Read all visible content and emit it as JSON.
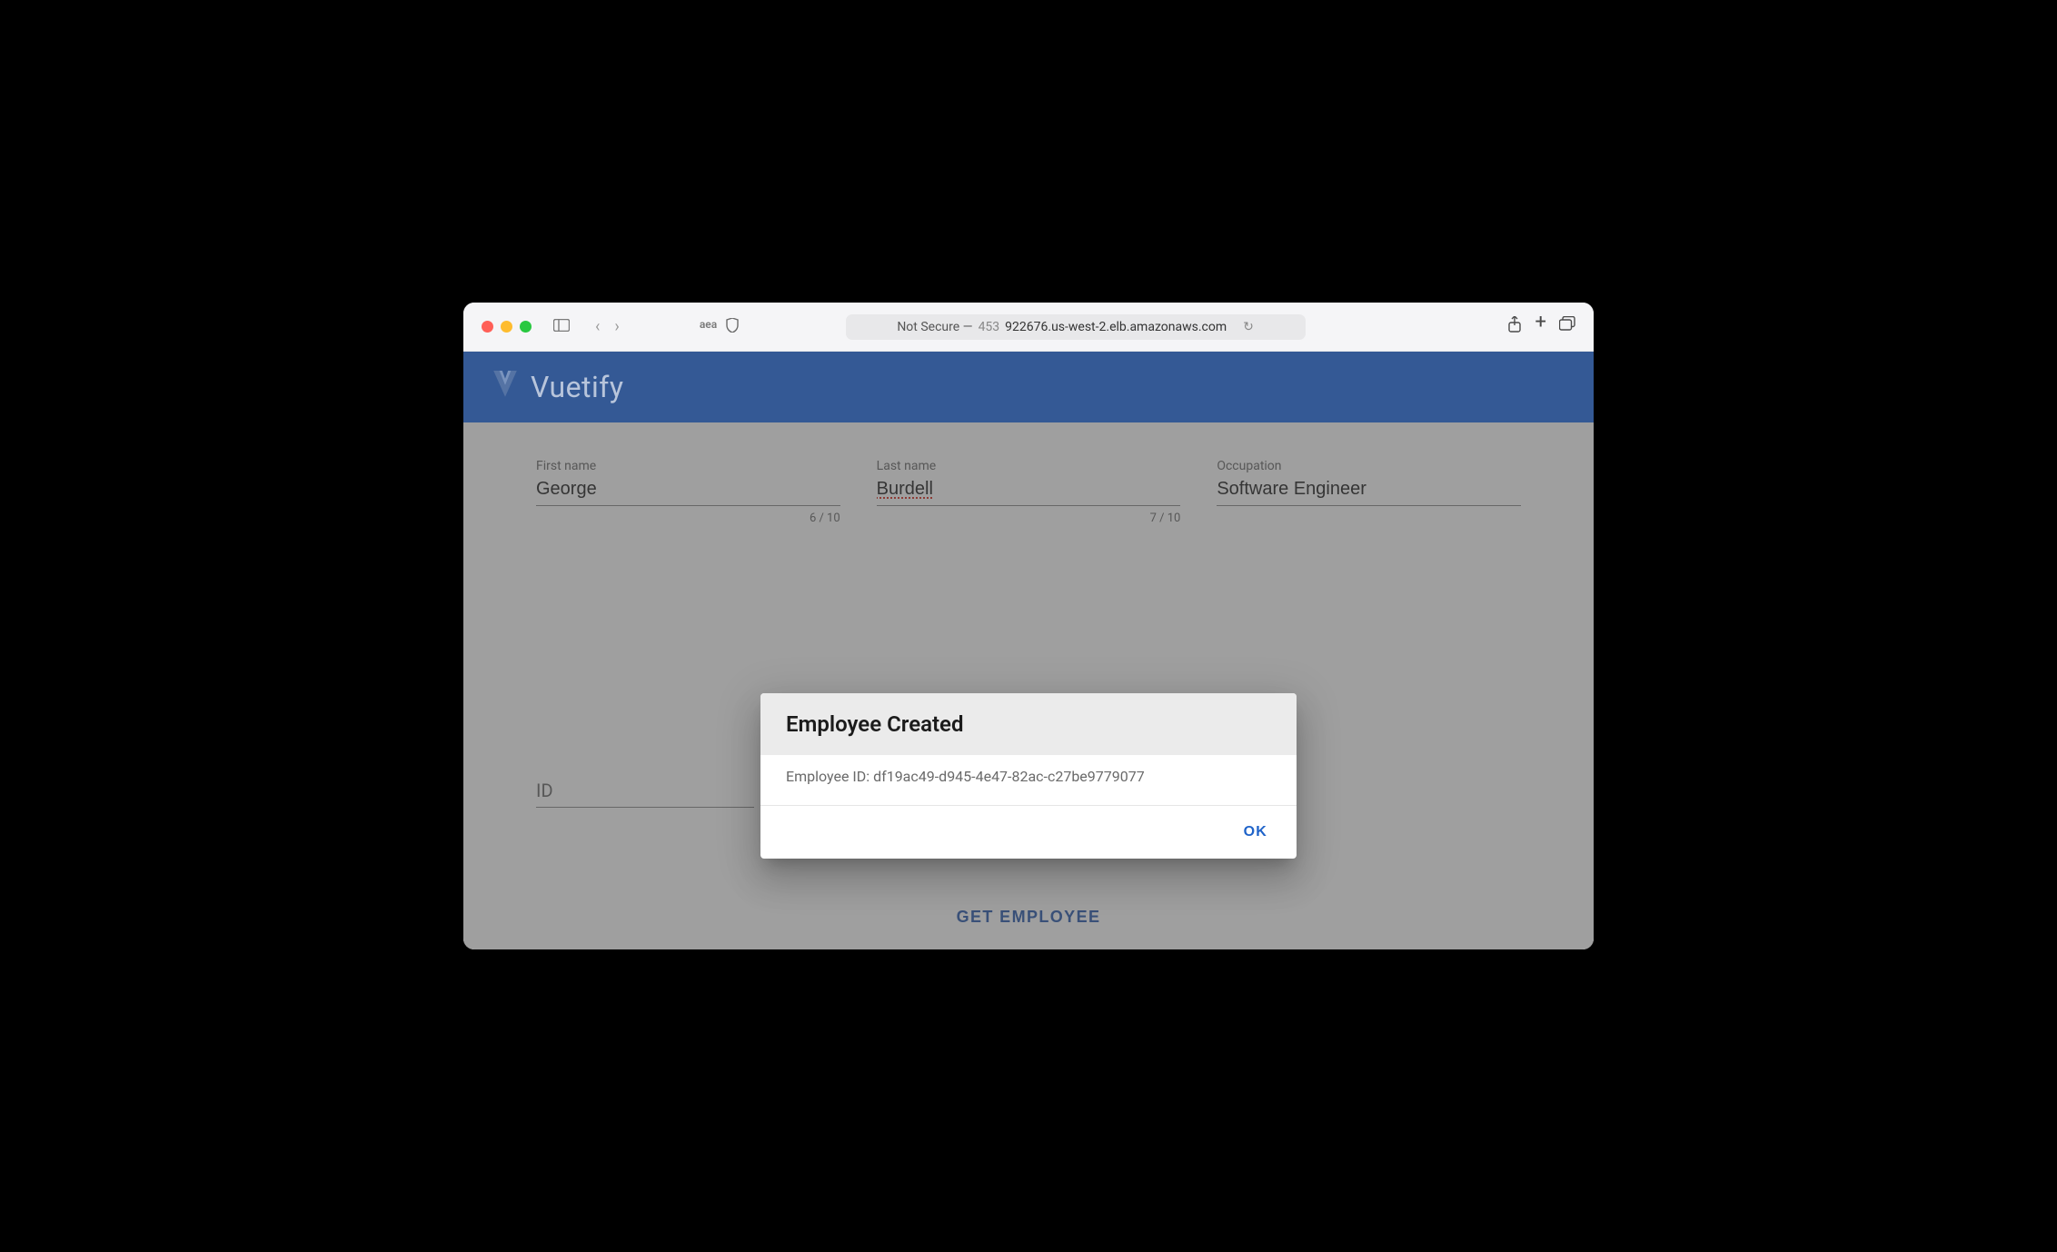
{
  "browser": {
    "not_secure_prefix": "Not Secure — ",
    "url_muted": "453",
    "url_rest": "922676.us-west-2.elb.amazonaws.com"
  },
  "appbar": {
    "brand": "Vuetify"
  },
  "form": {
    "first_name": {
      "label": "First name",
      "value": "George",
      "counter": "6 / 10"
    },
    "last_name": {
      "label": "Last name",
      "value": "Burdell",
      "counter": "7 / 10"
    },
    "occupation": {
      "label": "Occupation",
      "value": "Software Engineer"
    },
    "id": {
      "label": "ID",
      "value": ""
    }
  },
  "buttons": {
    "get_employee": "GET EMPLOYEE"
  },
  "dialog": {
    "title": "Employee Created",
    "body": "Employee ID: df19ac49-d945-4e47-82ac-c27be9779077",
    "ok": "OK"
  }
}
